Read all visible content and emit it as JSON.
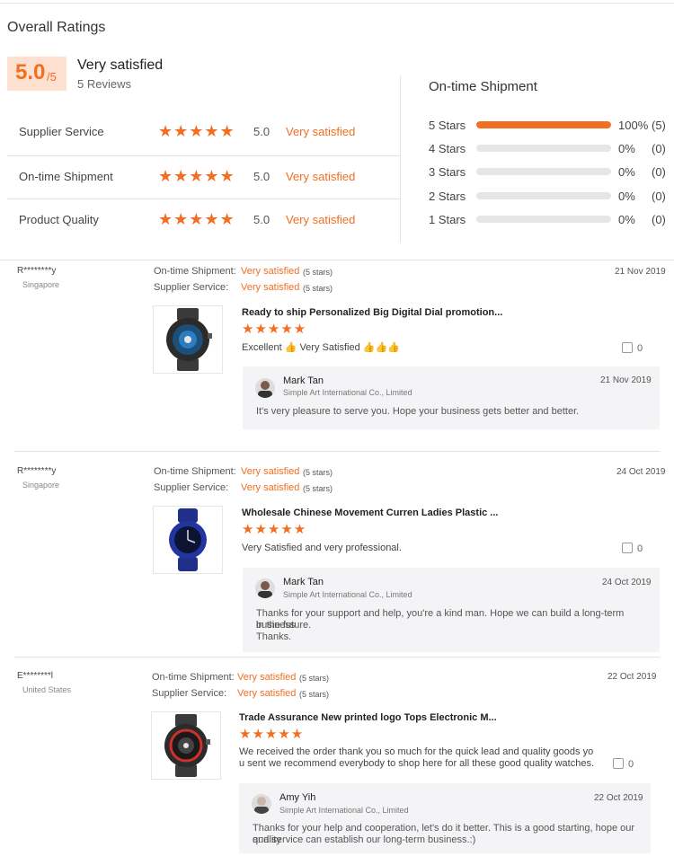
{
  "summary": {
    "title": "Overall Ratings",
    "score": "5.0",
    "score_max": "/5",
    "verdict": "Very satisfied",
    "reviews_count": "5 Reviews",
    "rows": [
      {
        "label": "Supplier Service",
        "stars": "★★★★★",
        "value": "5.0",
        "text": "Very satisfied"
      },
      {
        "label": "On-time Shipment",
        "stars": "★★★★★",
        "value": "5.0",
        "text": "Very satisfied"
      },
      {
        "label": "Product Quality",
        "stars": "★★★★★",
        "value": "5.0",
        "text": "Very satisfied"
      }
    ]
  },
  "shipment": {
    "title": "On-time Shipment",
    "bars": [
      {
        "label": "5 Stars",
        "fraction": 1.0,
        "pct": "100%",
        "count": "(5)"
      },
      {
        "label": "4 Stars",
        "fraction": 0.0,
        "pct": "0%",
        "count": "(0)"
      },
      {
        "label": "3 Stars",
        "fraction": 0.0,
        "pct": "0%",
        "count": "(0)"
      },
      {
        "label": "2 Stars",
        "fraction": 0.0,
        "pct": "0%",
        "count": "(0)"
      },
      {
        "label": "1 Stars",
        "fraction": 0.0,
        "pct": "0%",
        "count": "(0)"
      }
    ],
    "accent_color": "#f26e22"
  },
  "reviews": [
    {
      "name": "R********y",
      "country": "Singapore",
      "shipment_label": "On-time Shipment:",
      "shipment_value": "Very satisfied",
      "shipment_stars": "(5 stars)",
      "service_label": "Supplier Service:",
      "service_value": "Very satisfied",
      "service_stars": "(5 stars)",
      "date": "21 Nov 2019",
      "product_title": "Ready to ship Personalized Big Digital Dial promotion...",
      "product_stars": "★★★★★",
      "comment": "Excellent 👍 Very Satisfied 👍👍👍",
      "likes": "0",
      "reply": {
        "name": "Mark Tan",
        "company": "Simple Art International Co., Limited",
        "date": "21 Nov 2019",
        "text": "It's very pleasure to serve you.  Hope your business gets better and better."
      }
    },
    {
      "name": "R********y",
      "country": "Singapore",
      "shipment_label": "On-time Shipment:",
      "shipment_value": "Very satisfied",
      "shipment_stars": "(5 stars)",
      "service_label": "Supplier Service:",
      "service_value": "Very satisfied",
      "service_stars": "(5 stars)",
      "date": "24 Oct 2019",
      "product_title": "Wholesale Chinese Movement Curren Ladies Plastic ...",
      "product_stars": "★★★★★",
      "comment": "Very Satisfied and very professional.",
      "likes": "0",
      "reply": {
        "name": "Mark Tan",
        "company": "Simple Art International Co., Limited",
        "date": "24 Oct 2019",
        "text_lines": [
          "Thanks for your support and help, you're a kind man. Hope we can build  a long-term business",
          "in the future.",
          "Thanks."
        ]
      }
    },
    {
      "name": "E********l",
      "country": "United States",
      "shipment_label": "On-time Shipment:",
      "shipment_value": "Very satisfied",
      "shipment_stars": "(5 stars)",
      "service_label": "Supplier Service:",
      "service_value": "Very satisfied",
      "service_stars": "(5 stars)",
      "date": "22 Oct 2019",
      "product_title": "Trade Assurance New printed logo Tops Electronic M...",
      "product_stars": "★★★★★",
      "comment_lines": [
        "We received the order thank you so much  for the quick lead and quality goods yo",
        "u sent we recommend everybody to shop here for all these good quality watches."
      ],
      "likes": "0",
      "reply": {
        "name": "Amy Yih",
        "company": "Simple Art International Co., Limited",
        "date": "22 Oct 2019",
        "text_lines": [
          "Thanks for your help and cooperation, let's do it better. This is a good starting, hope our quality",
          "and service can establish our long-term business.:)"
        ]
      }
    }
  ]
}
